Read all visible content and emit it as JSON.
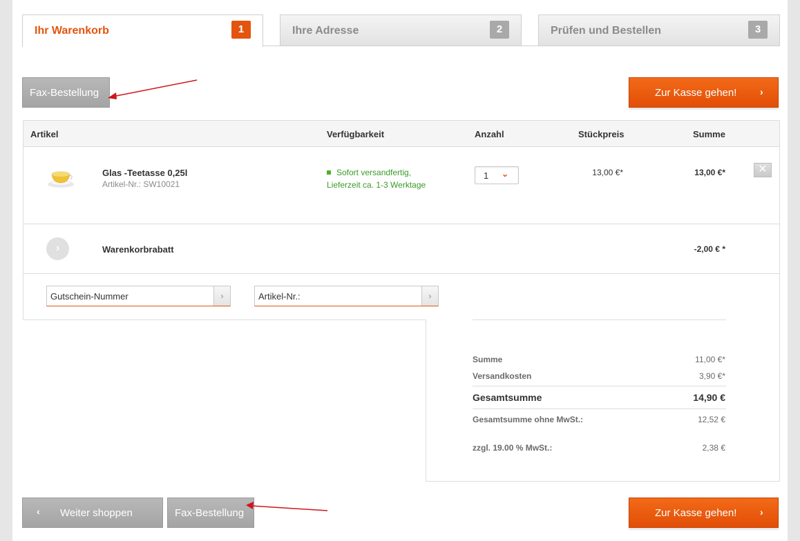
{
  "steps": [
    {
      "label": "Ihr Warenkorb",
      "number": "1"
    },
    {
      "label": "Ihre Adresse",
      "number": "2"
    },
    {
      "label": "Prüfen und Bestellen",
      "number": "3"
    }
  ],
  "actions": {
    "fax_order": "Fax-Bestellung",
    "checkout": "Zur Kasse gehen!",
    "continue_shopping": "Weiter shoppen",
    "chevron_right": "›",
    "chevron_left": "‹"
  },
  "table": {
    "headers": {
      "article": "Artikel",
      "availability": "Verfügbarkeit",
      "quantity": "Anzahl",
      "unit_price": "Stückpreis",
      "total": "Summe"
    },
    "items": [
      {
        "name": "Glas -Teetasse 0,25l",
        "sku": "Artikel-Nr.: SW10021",
        "availability_line1": "Sofort versandfertig,",
        "availability_line2": "Lieferzeit ca. 1-3 Werktage",
        "quantity": "1",
        "unit_price": "13,00 €*",
        "total": "13,00 €*",
        "remove": "✕"
      }
    ],
    "discount": {
      "label": "Warenkorbrabatt",
      "value": "-2,00 € *"
    },
    "voucher_placeholder": "Gutschein-Nummer",
    "article_no_placeholder": "Artikel-Nr.:"
  },
  "totals": {
    "subtotal_label": "Summe",
    "subtotal_value": "11,00 €*",
    "shipping_label": "Versandkosten",
    "shipping_value": "3,90 €*",
    "grand_label": "Gesamtsumme",
    "grand_value": "14,90 €",
    "net_label": "Gesamtsumme ohne MwSt.:",
    "net_value": "12,52 €",
    "vat_label": "zzgl. 19.00 % MwSt.:",
    "vat_value": "2,38 €"
  },
  "colors": {
    "accent": "#e3540e",
    "grey_button": "#a9a9a9",
    "availability": "#3a9a27",
    "annotation_arrow": "#d0141c"
  }
}
